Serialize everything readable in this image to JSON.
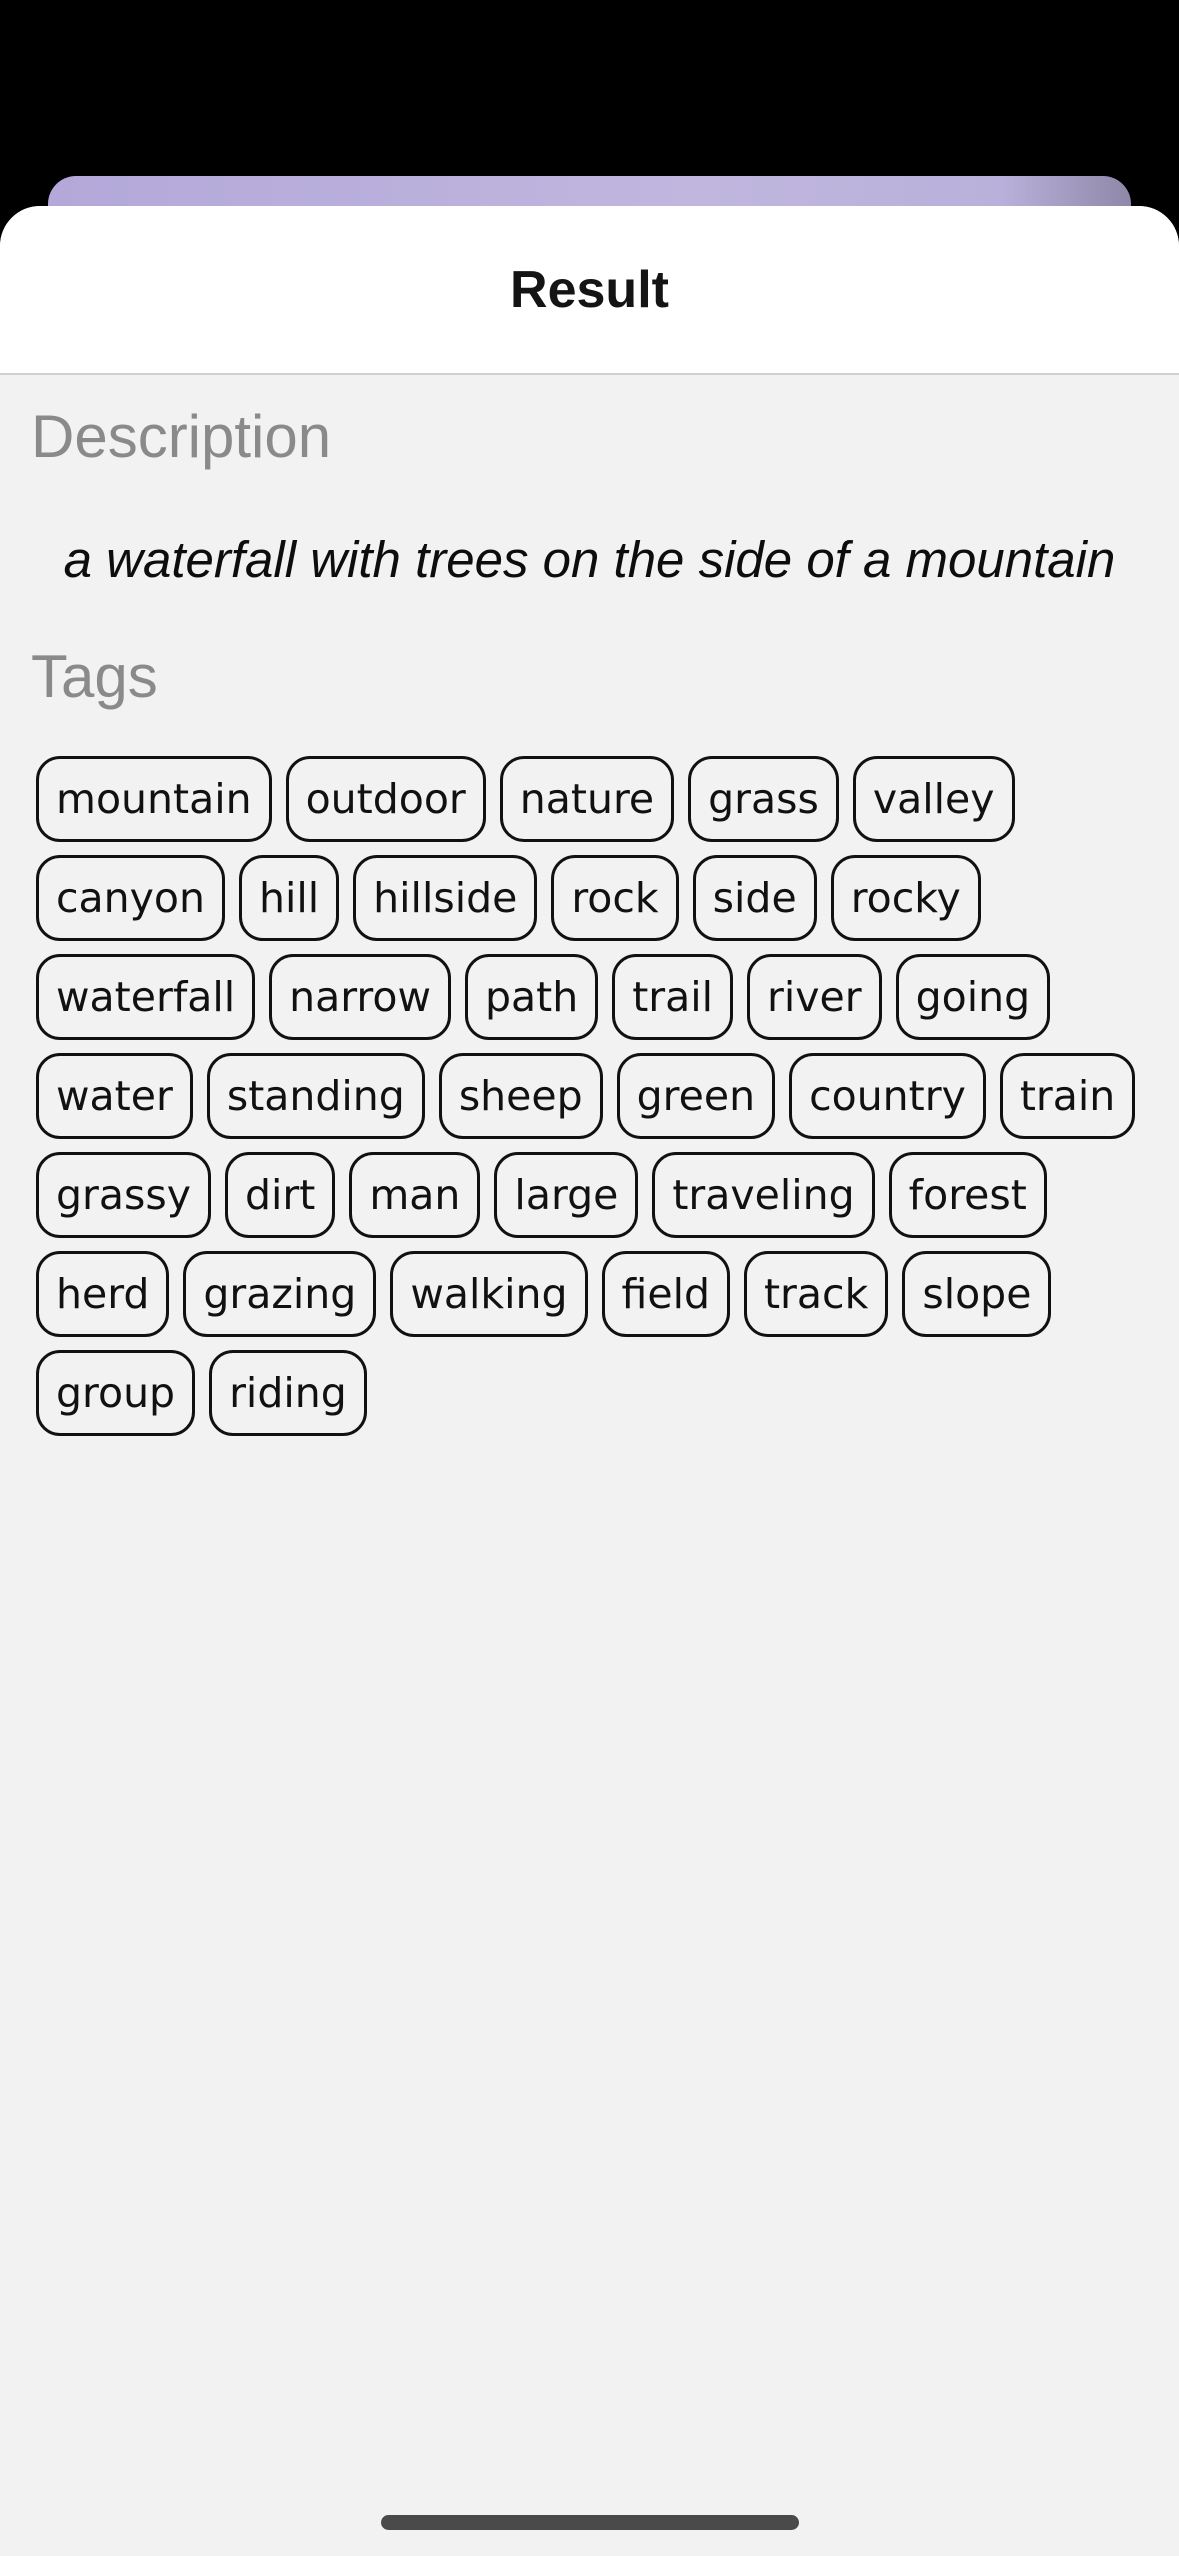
{
  "sheet": {
    "title": "Result"
  },
  "description": {
    "heading": "Description",
    "text": "a waterfall with trees on the side of a mountain"
  },
  "tags": {
    "heading": "Tags",
    "items": [
      "mountain",
      "outdoor",
      "nature",
      "grass",
      "valley",
      "canyon",
      "hill",
      "hillside",
      "rock",
      "side",
      "rocky",
      "waterfall",
      "narrow",
      "path",
      "trail",
      "river",
      "going",
      "water",
      "standing",
      "sheep",
      "green",
      "country",
      "train",
      "grassy",
      "dirt",
      "man",
      "large",
      "traveling",
      "forest",
      "herd",
      "grazing",
      "walking",
      "field",
      "track",
      "slope",
      "group",
      "riding"
    ]
  },
  "colors": {
    "backdrop": "#000000",
    "sheet_background": "#f2f2f2",
    "header_background": "#ffffff",
    "heading_gray": "#8a8a8a",
    "tag_border": "#111111",
    "background_card": "#c0b6de"
  }
}
